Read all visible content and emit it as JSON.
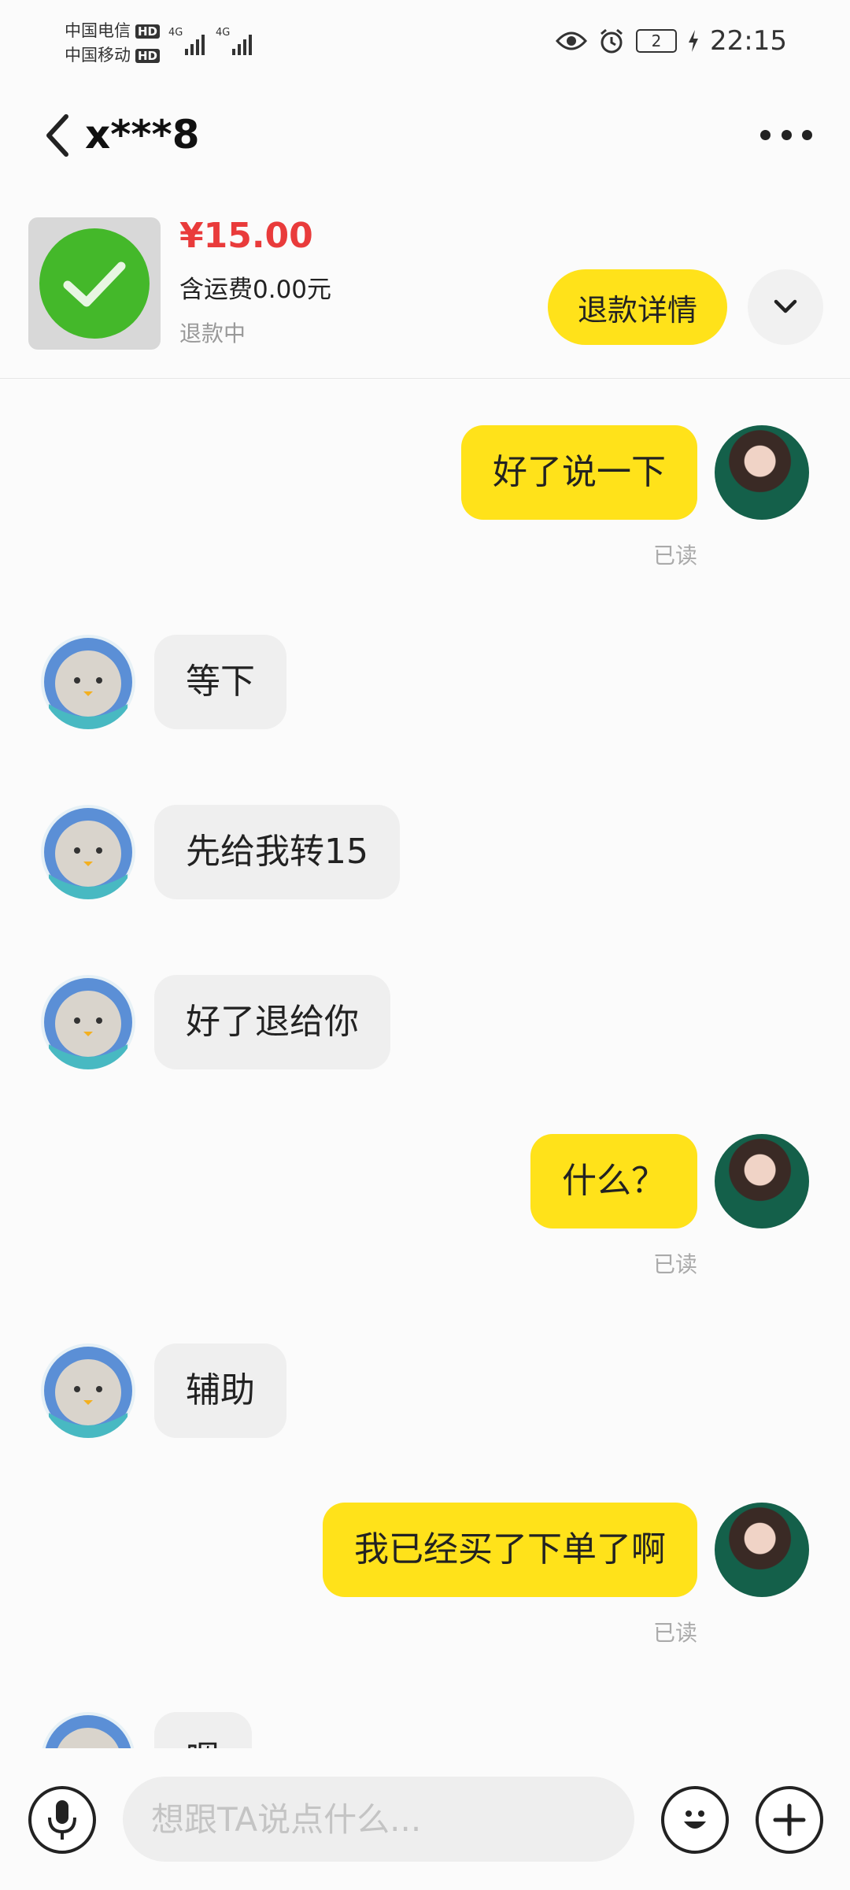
{
  "status_bar": {
    "carrier_1": "中国电信",
    "carrier_2": "中国移动",
    "hd": "HD",
    "network_1": "4G",
    "network_2": "4G",
    "battery": "2",
    "time": "22:15"
  },
  "header": {
    "title": "x***8"
  },
  "product": {
    "price": "¥15.00",
    "shipping": "含运费0.00元",
    "state": "退款中",
    "refund_button": "退款详情"
  },
  "messages": [
    {
      "sender": "me",
      "text": "好了说一下",
      "read": "已读"
    },
    {
      "sender": "other",
      "text": "等下"
    },
    {
      "sender": "other",
      "text": "先给我转15"
    },
    {
      "sender": "other",
      "text": "好了退给你"
    },
    {
      "sender": "me",
      "text": "什么？",
      "read": "已读"
    },
    {
      "sender": "other",
      "text": "辅助"
    },
    {
      "sender": "me",
      "text": "我已经买了下单了啊",
      "read": "已读"
    },
    {
      "sender": "other",
      "text": "嗯"
    }
  ],
  "input": {
    "placeholder": "想跟TA说点什么..."
  },
  "colors": {
    "accent": "#ffe21a",
    "price": "#e93b3b",
    "check": "#44b82a"
  }
}
